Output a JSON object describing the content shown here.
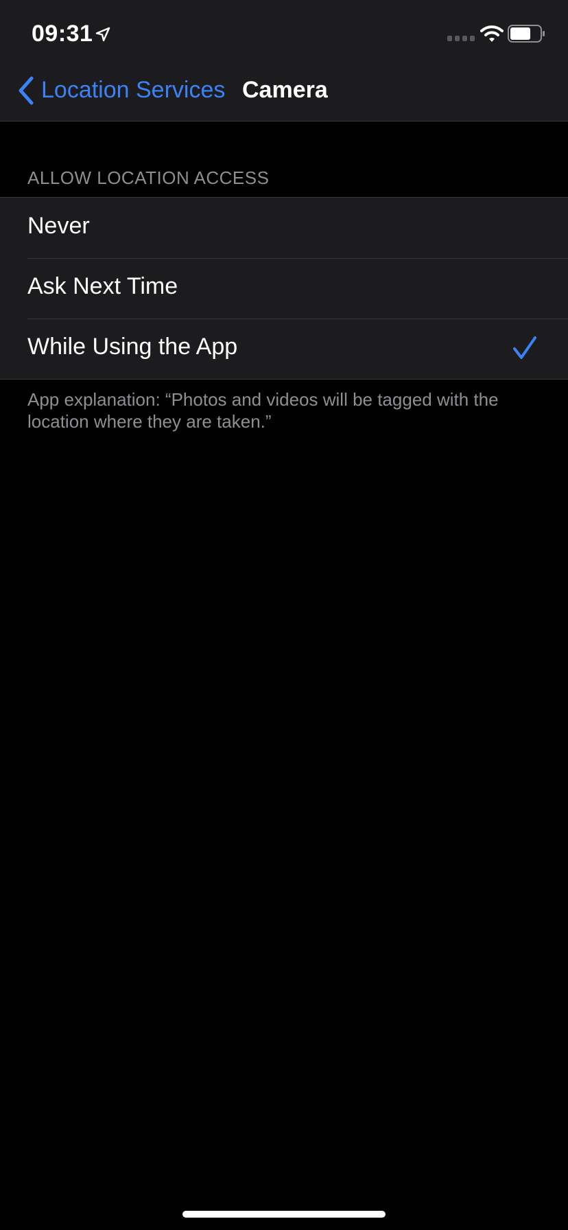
{
  "status_bar": {
    "time": "09:31",
    "icons": [
      "location-arrow-icon",
      "cellular-signal-icon",
      "wifi-icon",
      "battery-icon"
    ]
  },
  "nav": {
    "back_label": "Location Services",
    "title": "Camera",
    "back_icon": "chevron-left-icon"
  },
  "section": {
    "header": "ALLOW LOCATION ACCESS",
    "options": [
      {
        "label": "Never",
        "selected": false
      },
      {
        "label": "Ask Next Time",
        "selected": false
      },
      {
        "label": "While Using the App",
        "selected": true
      }
    ],
    "footer": "App explanation: “Photos and videos will be tagged with the location where they are taken.”"
  },
  "colors": {
    "accent": "#3b82f6",
    "background": "#000000",
    "cell": "#1c1c1e",
    "secondary_text": "#8e8e93"
  }
}
